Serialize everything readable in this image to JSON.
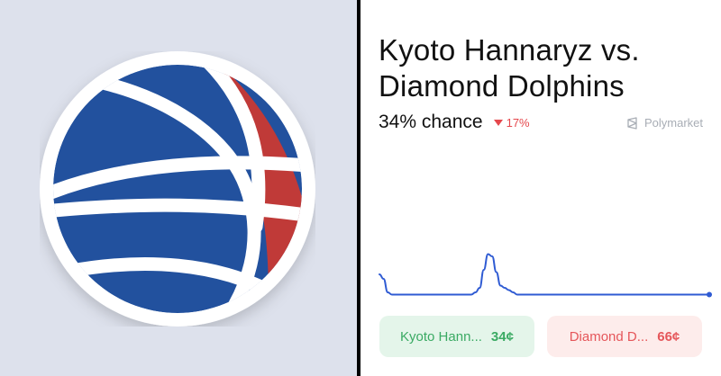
{
  "market": {
    "title": "Kyoto Hannaryz vs. Diamond Dolphins",
    "chance": "34% chance",
    "change": "17%",
    "change_direction": "down",
    "source": "Polymarket"
  },
  "colors": {
    "ball_blue": "#22519e",
    "ball_red": "#c03a38",
    "line": "#2f5bd3",
    "yes_text": "#3aaa63",
    "no_text": "#e5565a",
    "down": "#e5484d"
  },
  "chart_data": {
    "type": "line",
    "title": "",
    "xlabel": "",
    "ylabel": "",
    "series": [
      {
        "values": [
          40,
          38,
          32,
          31,
          31,
          31,
          31,
          31,
          31,
          31,
          31,
          31,
          31,
          31,
          31,
          31,
          31,
          31,
          31,
          31,
          31,
          31,
          31,
          32,
          34,
          42,
          49,
          48,
          41,
          35,
          34,
          33,
          32,
          31,
          31,
          31,
          31,
          31,
          31,
          31,
          31,
          31,
          31,
          31,
          31,
          31,
          31,
          31,
          31,
          31,
          31,
          31,
          31,
          31,
          31,
          31,
          31,
          31,
          31,
          31,
          31,
          31,
          31,
          31,
          31,
          31,
          31,
          31,
          31,
          31,
          31,
          31,
          31,
          31,
          31,
          31,
          31,
          31,
          31,
          31
        ]
      }
    ],
    "ylim": [
      28,
      52
    ],
    "grid": false,
    "end_marker": true
  },
  "outcomes": [
    {
      "label": "Kyoto Hann...",
      "price": "34¢"
    },
    {
      "label": "Diamond D...",
      "price": "66¢"
    }
  ],
  "icons": {
    "logo": "basketball-icon",
    "source": "polymarket-icon",
    "change": "triangle-down-icon"
  }
}
